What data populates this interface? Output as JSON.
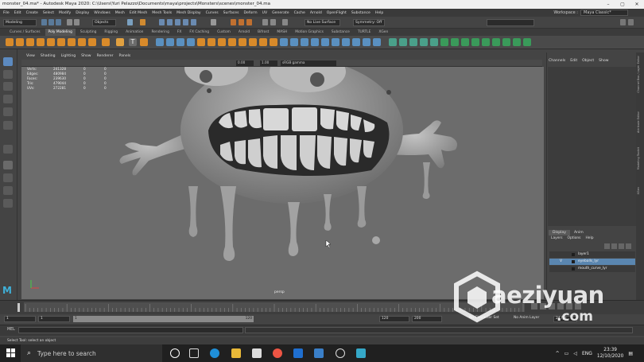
{
  "window": {
    "title": "monster_04.ma* - Autodesk Maya 2020: C:\\Users\\Yuri Pelazzo\\Documents\\maya\\projects\\Monsters\\scenes\\monster_04.ma",
    "min": "–",
    "max": "▢",
    "close": "✕"
  },
  "menubar": [
    "File",
    "Edit",
    "Create",
    "Select",
    "Modify",
    "Display",
    "Windows",
    "Mesh",
    "Edit Mesh",
    "Mesh Tools",
    "Mesh Display",
    "Curves",
    "Surfaces",
    "Deform",
    "UV",
    "Generate",
    "Cache",
    "Arnold",
    "OpenFlight",
    "Substance",
    "Help"
  ],
  "workspace": {
    "label": "Workspace :",
    "value": "Maya Classic*"
  },
  "statusline": {
    "mode": "Modeling",
    "objects": "Objects",
    "no_live": "No Live Surface",
    "symmetry": "Symmetry: Off"
  },
  "shelf_tabs": [
    "Curves / Surfaces",
    "Poly Modeling",
    "Sculpting",
    "Rigging",
    "Animation",
    "Rendering",
    "FX",
    "FX Caching",
    "Custom",
    "Arnold",
    "Bifrost",
    "MASH",
    "Motion Graphics",
    "Substance",
    "TURTLE",
    "XGen"
  ],
  "shelf_active": "Poly Modeling",
  "viewport_menu": [
    "View",
    "Shading",
    "Lighting",
    "Show",
    "Renderer",
    "Panels"
  ],
  "viewport_bar": {
    "exposure": "0.00",
    "gamma": "1.00",
    "colorspace": "sRGB gamma"
  },
  "hud": [
    {
      "label": "Verts:",
      "v1": "241328",
      "v2": "0",
      "v3": "0"
    },
    {
      "label": "Edges:",
      "v1": "480984",
      "v2": "0",
      "v3": "0"
    },
    {
      "label": "Faces:",
      "v1": "239630",
      "v2": "0",
      "v3": "0"
    },
    {
      "label": "Tris:",
      "v1": "479044",
      "v2": "0",
      "v3": "0"
    },
    {
      "label": "UVs:",
      "v1": "272281",
      "v2": "0",
      "v3": "0"
    }
  ],
  "camera_label": "persp",
  "channel_box": {
    "tabs": [
      "Channels",
      "Edit",
      "Object",
      "Show"
    ]
  },
  "layer_editor": {
    "tabs": [
      "Display",
      "Anim"
    ],
    "menus": [
      "Layers",
      "Options",
      "Help"
    ],
    "layers": [
      {
        "name": "layer1",
        "flag": "",
        "selected": false
      },
      {
        "name": "eyeballs_lyr",
        "flag": "V",
        "selected": true
      },
      {
        "name": "mouth_curve_lyr",
        "flag": "",
        "selected": false
      }
    ]
  },
  "side_labels": [
    "Channel Box / Layer Editor",
    "Attribute Editor",
    "Modeling Toolkit",
    "XGen"
  ],
  "timeline": {
    "start": "1",
    "end": "120"
  },
  "range": {
    "start": "1",
    "inner_start": "1",
    "inner_end": "120",
    "end": "120",
    "max": "200",
    "char_set": "No Character Set",
    "anim_layer": "No Anim Layer",
    "fps": "24 fps"
  },
  "command_line": {
    "label": "MEL"
  },
  "help_line": "Select Tool: select an object",
  "taskbar": {
    "search_placeholder": "Type here to search",
    "lang": "ENG",
    "time": "23:39",
    "date": "12/10/2020"
  },
  "watermark": {
    "line1": "aeziyuan",
    "line2": ".com"
  }
}
